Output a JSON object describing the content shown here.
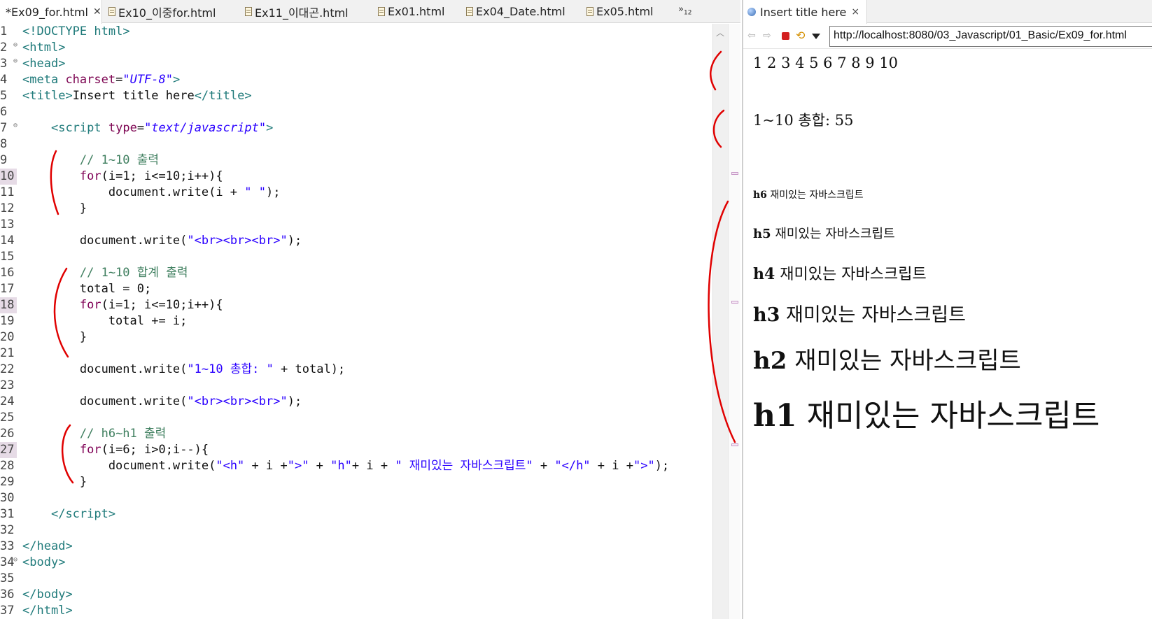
{
  "editor": {
    "tabs": [
      {
        "label": "*Ex09_for.html",
        "active": true,
        "closable": true
      },
      {
        "label": "Ex10_이중for.html"
      },
      {
        "label": "Ex11_이대곤.html"
      },
      {
        "label": "Ex01.html"
      },
      {
        "label": "Ex04_Date.html"
      },
      {
        "label": "Ex05.html"
      }
    ],
    "overflow_label": "»",
    "overflow_count": "12",
    "lines": [
      {
        "n": "1",
        "fold": "",
        "tokens": [
          [
            "tag",
            "<!DOCTYPE "
          ],
          [
            "name",
            "html"
          ],
          [
            "tag",
            ">"
          ]
        ]
      },
      {
        "n": "2",
        "fold": "⊖",
        "tokens": [
          [
            "tag",
            "<"
          ],
          [
            "name",
            "html"
          ],
          [
            "tag",
            ">"
          ]
        ]
      },
      {
        "n": "3",
        "fold": "⊖",
        "tokens": [
          [
            "tag",
            "<"
          ],
          [
            "name",
            "head"
          ],
          [
            "tag",
            ">"
          ]
        ]
      },
      {
        "n": "4",
        "fold": "",
        "tokens": [
          [
            "tag",
            "<"
          ],
          [
            "name",
            "meta "
          ],
          [
            "attr",
            "charset"
          ],
          [
            "txt",
            "="
          ],
          [
            "str",
            "\"UTF-8\""
          ],
          [
            "tag",
            ">"
          ]
        ]
      },
      {
        "n": "5",
        "fold": "",
        "tokens": [
          [
            "tag",
            "<"
          ],
          [
            "name",
            "title"
          ],
          [
            "tag",
            ">"
          ],
          [
            "txt",
            "Insert title here"
          ],
          [
            "tag",
            "</"
          ],
          [
            "name",
            "title"
          ],
          [
            "tag",
            ">"
          ]
        ]
      },
      {
        "n": "6",
        "fold": "",
        "tokens": []
      },
      {
        "n": "7",
        "fold": "⊖",
        "tokens": [
          [
            "txt",
            "    "
          ],
          [
            "tag",
            "<"
          ],
          [
            "name",
            "script "
          ],
          [
            "attr",
            "type"
          ],
          [
            "txt",
            "="
          ],
          [
            "str",
            "\"text/javascript\""
          ],
          [
            "tag",
            ">"
          ]
        ]
      },
      {
        "n": "8",
        "fold": "",
        "tokens": []
      },
      {
        "n": "9",
        "fold": "",
        "tokens": [
          [
            "txt",
            "        "
          ],
          [
            "com",
            "// 1~10 출력"
          ]
        ]
      },
      {
        "n": "10",
        "fold": "",
        "hl": true,
        "tokens": [
          [
            "txt",
            "        "
          ],
          [
            "kw",
            "for"
          ],
          [
            "txt",
            "(i=1; i<=10;i++){"
          ]
        ]
      },
      {
        "n": "11",
        "fold": "",
        "tokens": [
          [
            "txt",
            "            document.write(i + "
          ],
          [
            "jstr",
            "\" \""
          ],
          [
            "txt",
            ");"
          ]
        ]
      },
      {
        "n": "12",
        "fold": "",
        "tokens": [
          [
            "txt",
            "        }"
          ]
        ]
      },
      {
        "n": "13",
        "fold": "",
        "tokens": []
      },
      {
        "n": "14",
        "fold": "",
        "tokens": [
          [
            "txt",
            "        document.write("
          ],
          [
            "jstr",
            "\"<br><br><br>\""
          ],
          [
            "txt",
            ");"
          ]
        ]
      },
      {
        "n": "15",
        "fold": "",
        "tokens": []
      },
      {
        "n": "16",
        "fold": "",
        "tokens": [
          [
            "txt",
            "        "
          ],
          [
            "com",
            "// 1~10 합계 출력"
          ]
        ]
      },
      {
        "n": "17",
        "fold": "",
        "tokens": [
          [
            "txt",
            "        total = 0;"
          ]
        ]
      },
      {
        "n": "18",
        "fold": "",
        "hl": true,
        "tokens": [
          [
            "txt",
            "        "
          ],
          [
            "kw",
            "for"
          ],
          [
            "txt",
            "(i=1; i<=10;i++){"
          ]
        ]
      },
      {
        "n": "19",
        "fold": "",
        "tokens": [
          [
            "txt",
            "            total += i;"
          ]
        ]
      },
      {
        "n": "20",
        "fold": "",
        "tokens": [
          [
            "txt",
            "        }"
          ]
        ]
      },
      {
        "n": "21",
        "fold": "",
        "tokens": []
      },
      {
        "n": "22",
        "fold": "",
        "tokens": [
          [
            "txt",
            "        document.write("
          ],
          [
            "jstr",
            "\"1~10 총합: \""
          ],
          [
            "txt",
            " + total);"
          ]
        ]
      },
      {
        "n": "23",
        "fold": "",
        "tokens": []
      },
      {
        "n": "24",
        "fold": "",
        "tokens": [
          [
            "txt",
            "        document.write("
          ],
          [
            "jstr",
            "\"<br><br><br>\""
          ],
          [
            "txt",
            ");"
          ]
        ]
      },
      {
        "n": "25",
        "fold": "",
        "tokens": []
      },
      {
        "n": "26",
        "fold": "",
        "tokens": [
          [
            "txt",
            "        "
          ],
          [
            "com",
            "// h6~h1 출력"
          ]
        ]
      },
      {
        "n": "27",
        "fold": "",
        "hl": true,
        "tokens": [
          [
            "txt",
            "        "
          ],
          [
            "kw",
            "for"
          ],
          [
            "txt",
            "(i=6; i>0;i--){"
          ]
        ]
      },
      {
        "n": "28",
        "fold": "",
        "tokens": [
          [
            "txt",
            "            document.write("
          ],
          [
            "jstr",
            "\"<h\""
          ],
          [
            "txt",
            " + i +"
          ],
          [
            "jstr",
            "\">\""
          ],
          [
            "txt",
            " + "
          ],
          [
            "jstr",
            "\"h\""
          ],
          [
            "txt",
            "+ i + "
          ],
          [
            "jstr",
            "\" 재미있는 자바스크립트\""
          ],
          [
            "txt",
            " + "
          ],
          [
            "jstr",
            "\"</h\""
          ],
          [
            "txt",
            " + i +"
          ],
          [
            "jstr",
            "\">\""
          ],
          [
            "txt",
            ");"
          ]
        ]
      },
      {
        "n": "29",
        "fold": "",
        "tokens": [
          [
            "txt",
            "        }"
          ]
        ]
      },
      {
        "n": "30",
        "fold": "",
        "tokens": []
      },
      {
        "n": "31",
        "fold": "",
        "tokens": [
          [
            "txt",
            "    "
          ],
          [
            "tag",
            "</"
          ],
          [
            "name",
            "script"
          ],
          [
            "tag",
            ">"
          ]
        ]
      },
      {
        "n": "32",
        "fold": "",
        "tokens": []
      },
      {
        "n": "33",
        "fold": "",
        "tokens": [
          [
            "tag",
            "</"
          ],
          [
            "name",
            "head"
          ],
          [
            "tag",
            ">"
          ]
        ]
      },
      {
        "n": "34",
        "fold": "⊖",
        "tokens": [
          [
            "tag",
            "<"
          ],
          [
            "name",
            "body"
          ],
          [
            "tag",
            ">"
          ]
        ]
      },
      {
        "n": "35",
        "fold": "",
        "tokens": []
      },
      {
        "n": "36",
        "fold": "",
        "tokens": [
          [
            "tag",
            "</"
          ],
          [
            "name",
            "body"
          ],
          [
            "tag",
            ">"
          ]
        ]
      },
      {
        "n": "37",
        "fold": "",
        "tokens": [
          [
            "tag",
            "</"
          ],
          [
            "name",
            "html"
          ],
          [
            "tag",
            ">"
          ]
        ]
      }
    ]
  },
  "browser": {
    "tab_title": "Insert title here",
    "tab_close": "×",
    "url": "http://localhost:8080/03_Javascript/01_Basic/Ex09_for.html",
    "back_icon": "back-arrow-icon",
    "forward_icon": "forward-arrow-icon",
    "output": {
      "numbers": "1 2 3 4 5 6 7 8 9 10",
      "sum_line": "1~10 총합: 55",
      "headings": [
        {
          "level": 6,
          "prefix": "h6",
          "text": " 재미있는 자바스크립트"
        },
        {
          "level": 5,
          "prefix": "h5",
          "text": " 재미있는 자바스크립트"
        },
        {
          "level": 4,
          "prefix": "h4",
          "text": " 재미있는 자바스크립트"
        },
        {
          "level": 3,
          "prefix": "h3",
          "text": " 재미있는 자바스크립트"
        },
        {
          "level": 2,
          "prefix": "h2",
          "text": " 재미있는 자바스크립트"
        },
        {
          "level": 1,
          "prefix": "h1",
          "text": " 재미있는 자바스크립트"
        }
      ]
    }
  },
  "colors": {
    "annotation": "#e00000",
    "tag": "#1f7a7a",
    "keyword": "#7f0055",
    "string": "#2a00ff",
    "comment": "#3f7f5f"
  }
}
